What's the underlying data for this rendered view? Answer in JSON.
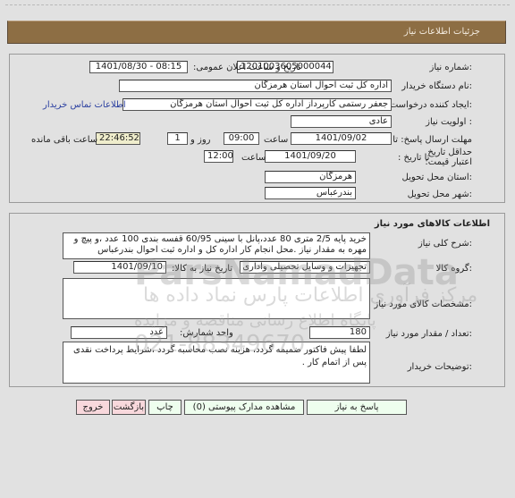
{
  "header": {
    "title": "جزئیات اطلاعات نیاز"
  },
  "need_info": {
    "need_number": {
      "label": "شماره نیاز:",
      "value": "1201003605000044"
    },
    "announce": {
      "label": "تاریخ و ساعت اعلان عمومی:",
      "value": "1401/08/30 - 08:15"
    },
    "buyer_org": {
      "label": "نام دستگاه خریدار:",
      "value": "اداره کل ثبت احوال استان هرمزگان"
    },
    "requester": {
      "label": "ایجاد کننده درخواست:",
      "value": "جعفر رستمی کارپرداز اداره کل ثبت احوال استان هرمزگان"
    },
    "buyer_contact_link": "اطلاعات تماس خریدار",
    "priority": {
      "label": "اولویت نیاز :",
      "value": "عادی"
    },
    "reply_deadline": {
      "label": "مهلت ارسال پاسخ: تا تاریخ :",
      "date": "1401/09/02",
      "time_label": "ساعت",
      "time": "09:00",
      "days": "1",
      "days_label": "روز و",
      "remaining": "22:46:52",
      "remaining_label": "ساعت باقی مانده"
    },
    "price_validity": {
      "label": "حداقل تاریخ اعتبار قیمت:",
      "to_label": "تا تاریخ :",
      "date": "1401/09/20",
      "time_label": "ساعت",
      "time": "12:00"
    },
    "delivery_province": {
      "label": "استان محل تحویل:",
      "value": "هرمزگان"
    },
    "delivery_city": {
      "label": "شهر محل تحویل:",
      "value": "بندرعباس"
    }
  },
  "goods": {
    "section_title": "اطلاعات کالاهای مورد نیاز",
    "description": {
      "label": "شرح کلی نیاز:",
      "value": "خرید پایه 2/5 متری  80 عدد،پانل با سینی 60/95 قفسه بندی 100 عدد ،و پیچ و مهره به مقدار نیاز .محل انجام کار اداره کل و اداره ثبت احوال بندرعباس"
    },
    "group": {
      "label": "گروه کالا:",
      "value": "تجهیزات و وسایل تحصیلی واداری"
    },
    "need_date": {
      "label": "تاریخ نیاز به کالا:",
      "value": "1401/09/10"
    },
    "specs": {
      "label": "مشخصات کالای مورد نیاز:",
      "value": ""
    },
    "quantity": {
      "label": "تعداد / مقدار مورد نیاز:",
      "value": "180"
    },
    "unit": {
      "label": "واحد شمارش:",
      "value": "عدد"
    },
    "buyer_notes": {
      "label": "توضیحات خریدار:",
      "value": "لطفا پیش فاکتور ضمیمه گردد، هزینه نصب محاسبه گردد ،شرایط پرداخت نقدی پس از اتمام کار ."
    }
  },
  "buttons": {
    "reply": "پاسخ به نیاز",
    "attachments": "مشاهده مدارک پیوستی (0)",
    "print": "چاپ",
    "back": "بازگشت",
    "exit": "خروج"
  },
  "watermark": {
    "line1": "ParsNamadData",
    "line2": "مرکز فرآوری اطلاعات پارس نماد داده ها",
    "line3": "پایگاه اطلاع رسانی مناقصه و مزایده",
    "line4": "021-88349670"
  }
}
